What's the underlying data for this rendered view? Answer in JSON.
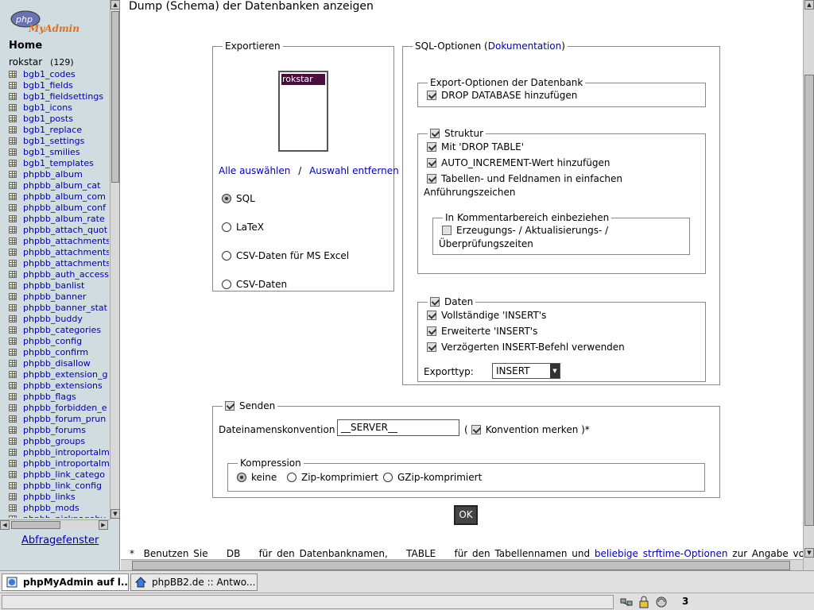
{
  "left": {
    "logo_php": "php",
    "logo_myadmin": "MyAdmin",
    "home": "Home",
    "db_name": "rokstar",
    "db_count": "(129)",
    "tables": [
      "bgb1_codes",
      "bgb1_fields",
      "bgb1_fieldsettings",
      "bgb1_icons",
      "bgb1_posts",
      "bgb1_replace",
      "bgb1_settings",
      "bgb1_smilies",
      "bgb1_templates",
      "phpbb_album",
      "phpbb_album_cat",
      "phpbb_album_com",
      "phpbb_album_conf",
      "phpbb_album_rate",
      "phpbb_attach_quot",
      "phpbb_attachments",
      "phpbb_attachments",
      "phpbb_attachments",
      "phpbb_auth_access",
      "phpbb_banlist",
      "phpbb_banner",
      "phpbb_banner_stat",
      "phpbb_buddy",
      "phpbb_categories",
      "phpbb_config",
      "phpbb_confirm",
      "phpbb_disallow",
      "phpbb_extension_g",
      "phpbb_extensions",
      "phpbb_flags",
      "phpbb_forbidden_e",
      "phpbb_forum_prun",
      "phpbb_forums",
      "phpbb_groups",
      "phpbb_introportalm",
      "phpbb_introportalm",
      "phpbb_link_catego",
      "phpbb_link_config",
      "phpbb_links",
      "phpbb_mods",
      "phpbb_nickpagebu"
    ],
    "query_window": "Abfragefenster"
  },
  "main": {
    "title": "Dump (Schema) der Datenbanken anzeigen",
    "export": {
      "legend": "Exportieren",
      "db_selected": "rokstar",
      "select_all": "Alle auswählen",
      "separator": "/",
      "deselect": "Auswahl entfernen",
      "formats": [
        {
          "label": "SQL",
          "checked": true
        },
        {
          "label": "LaTeX",
          "checked": false
        },
        {
          "label": "CSV-Daten für MS Excel",
          "checked": false
        },
        {
          "label": "CSV-Daten",
          "checked": false
        }
      ]
    },
    "sql_options": {
      "legend": "SQL-Optionen (",
      "doc_link": "Dokumentation",
      "legend_close": ")",
      "db_export": {
        "legend": "Export-Optionen der Datenbank",
        "drop_database": "DROP DATABASE hinzufügen"
      },
      "structure": {
        "legend": "Struktur",
        "drop_table": "Mit 'DROP TABLE'",
        "auto_increment": "AUTO_INCREMENT-Wert hinzufügen",
        "quotes_line1": "Tabellen- und Feldnamen in einfachen",
        "quotes_line2": "Anführungszeichen",
        "comments": {
          "legend": "In Kommentarbereich einbeziehen",
          "line1": "Erzeugungs- / Aktualisierungs- /",
          "line2": "Überprüfungszeiten"
        }
      },
      "data": {
        "legend": "Daten",
        "complete_inserts": "Vollständige 'INSERT's",
        "extended_inserts": "Erweiterte 'INSERT's",
        "delayed_insert": "Verzögerten INSERT-Befehl verwenden",
        "export_type_label": "Exporttyp:",
        "export_type_value": "INSERT"
      }
    },
    "send": {
      "legend": "Senden",
      "filename_label": "Dateinamenskonvention :",
      "filename_value": "__SERVER__",
      "paren_open": "(",
      "remember": "Konvention merken )*",
      "compression": {
        "legend": "Kompression",
        "options": [
          {
            "label": "keine",
            "checked": true
          },
          {
            "label": "Zip-komprimiert",
            "checked": false
          },
          {
            "label": "GZip-komprimiert",
            "checked": false
          }
        ]
      }
    },
    "ok_button": "OK",
    "footnote": {
      "part1": "*  Benutzen Sie    DB    für den Datenbanknamen,    TABLE    für den Tabellennamen und ",
      "link": "beliebige strftime-Optionen",
      "part2": " zur Angabe von"
    }
  },
  "taskbar": {
    "task1": "phpMyAdmin auf l...",
    "task2": "phpBB2.de :: Antwo..."
  },
  "status": {
    "count": "3"
  }
}
